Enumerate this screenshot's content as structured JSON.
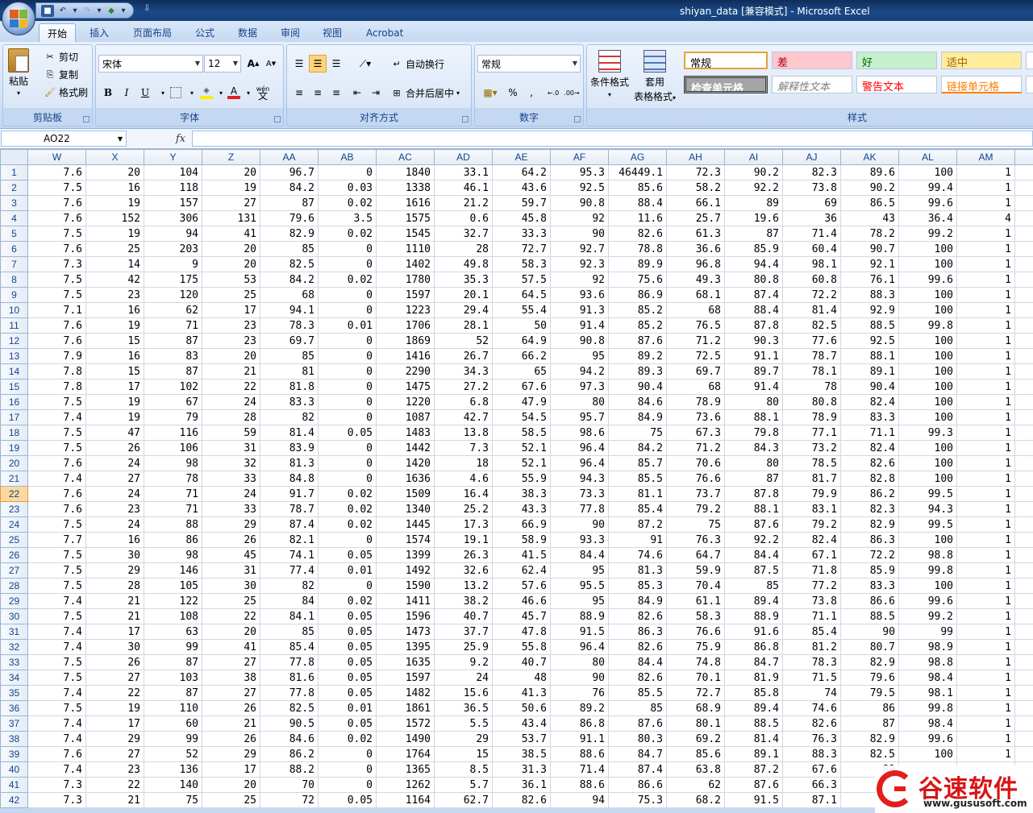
{
  "window": {
    "title": "shiyan_data  [兼容模式] - Microsoft Excel"
  },
  "tabs": [
    "开始",
    "插入",
    "页面布局",
    "公式",
    "数据",
    "审阅",
    "视图",
    "Acrobat"
  ],
  "ribbon": {
    "clipboard": {
      "label": "剪贴板",
      "paste": "粘贴",
      "cut": "剪切",
      "copy": "复制",
      "format_painter": "格式刷"
    },
    "font": {
      "label": "字体",
      "name": "宋体",
      "size": "12",
      "bold": "B",
      "italic": "I",
      "underline": "U",
      "grow": "A",
      "shrink": "A",
      "wen": "wén"
    },
    "alignment": {
      "label": "对齐方式",
      "wrap": "自动换行",
      "merge": "合并后居中"
    },
    "number": {
      "label": "数字",
      "format": "常规",
      "percent": "%",
      "comma": ","
    },
    "styles": {
      "label": "样式",
      "conditional": "条件格式",
      "table_fmt_1": "套用",
      "table_fmt_2": "表格格式",
      "normal": "常规",
      "bad": "差",
      "good": "好",
      "neutral": "适中",
      "check": "检查单元格",
      "explanatory": "解释性文本",
      "warning": "警告文本",
      "linked": "链接单元格"
    }
  },
  "formula_bar": {
    "name_box": "AO22",
    "fx": "fx",
    "value": ""
  },
  "sheet": {
    "columns": [
      "W",
      "X",
      "Y",
      "Z",
      "AA",
      "AB",
      "AC",
      "AD",
      "AE",
      "AF",
      "AG",
      "AH",
      "AI",
      "AJ",
      "AK",
      "AL",
      "AM"
    ],
    "selected_row": 22,
    "rows": [
      [
        "1",
        "7.6",
        "20",
        "104",
        "20",
        "96.7",
        "0",
        "1840",
        "33.1",
        "64.2",
        "95.3",
        "46449.1",
        "72.3",
        "90.2",
        "82.3",
        "89.6",
        "100",
        "1"
      ],
      [
        "2",
        "7.5",
        "16",
        "118",
        "19",
        "84.2",
        "0.03",
        "1338",
        "46.1",
        "43.6",
        "92.5",
        "85.6",
        "58.2",
        "92.2",
        "73.8",
        "90.2",
        "99.4",
        "1"
      ],
      [
        "3",
        "7.6",
        "19",
        "157",
        "27",
        "87",
        "0.02",
        "1616",
        "21.2",
        "59.7",
        "90.8",
        "88.4",
        "66.1",
        "89",
        "69",
        "86.5",
        "99.6",
        "1"
      ],
      [
        "4",
        "7.6",
        "152",
        "306",
        "131",
        "79.6",
        "3.5",
        "1575",
        "0.6",
        "45.8",
        "92",
        "11.6",
        "25.7",
        "19.6",
        "36",
        "43",
        "36.4",
        "4"
      ],
      [
        "5",
        "7.5",
        "19",
        "94",
        "41",
        "82.9",
        "0.02",
        "1545",
        "32.7",
        "33.3",
        "90",
        "82.6",
        "61.3",
        "87",
        "71.4",
        "78.2",
        "99.2",
        "1"
      ],
      [
        "6",
        "7.6",
        "25",
        "203",
        "20",
        "85",
        "0",
        "1110",
        "28",
        "72.7",
        "92.7",
        "78.8",
        "36.6",
        "85.9",
        "60.4",
        "90.7",
        "100",
        "1"
      ],
      [
        "7",
        "7.3",
        "14",
        "9",
        "20",
        "82.5",
        "0",
        "1402",
        "49.8",
        "58.3",
        "92.3",
        "89.9",
        "96.8",
        "94.4",
        "98.1",
        "92.1",
        "100",
        "1"
      ],
      [
        "8",
        "7.5",
        "42",
        "175",
        "53",
        "84.2",
        "0.02",
        "1780",
        "35.3",
        "57.5",
        "92",
        "75.6",
        "49.3",
        "80.8",
        "60.8",
        "76.1",
        "99.6",
        "1"
      ],
      [
        "9",
        "7.5",
        "23",
        "120",
        "25",
        "68",
        "0",
        "1597",
        "20.1",
        "64.5",
        "93.6",
        "86.9",
        "68.1",
        "87.4",
        "72.2",
        "88.3",
        "100",
        "1"
      ],
      [
        "10",
        "7.1",
        "16",
        "62",
        "17",
        "94.1",
        "0",
        "1223",
        "29.4",
        "55.4",
        "91.3",
        "85.2",
        "68",
        "88.4",
        "81.4",
        "92.9",
        "100",
        "1"
      ],
      [
        "11",
        "7.6",
        "19",
        "71",
        "23",
        "78.3",
        "0.01",
        "1706",
        "28.1",
        "50",
        "91.4",
        "85.2",
        "76.5",
        "87.8",
        "82.5",
        "88.5",
        "99.8",
        "1"
      ],
      [
        "12",
        "7.6",
        "15",
        "87",
        "23",
        "69.7",
        "0",
        "1869",
        "52",
        "64.9",
        "90.8",
        "87.6",
        "71.2",
        "90.3",
        "77.6",
        "92.5",
        "100",
        "1"
      ],
      [
        "13",
        "7.9",
        "16",
        "83",
        "20",
        "85",
        "0",
        "1416",
        "26.7",
        "66.2",
        "95",
        "89.2",
        "72.5",
        "91.1",
        "78.7",
        "88.1",
        "100",
        "1"
      ],
      [
        "14",
        "7.8",
        "15",
        "87",
        "21",
        "81",
        "0",
        "2290",
        "34.3",
        "65",
        "94.2",
        "89.3",
        "69.7",
        "89.7",
        "78.1",
        "89.1",
        "100",
        "1"
      ],
      [
        "15",
        "7.8",
        "17",
        "102",
        "22",
        "81.8",
        "0",
        "1475",
        "27.2",
        "67.6",
        "97.3",
        "90.4",
        "68",
        "91.4",
        "78",
        "90.4",
        "100",
        "1"
      ],
      [
        "16",
        "7.5",
        "19",
        "67",
        "24",
        "83.3",
        "0",
        "1220",
        "6.8",
        "47.9",
        "80",
        "84.6",
        "78.9",
        "80",
        "80.8",
        "82.4",
        "100",
        "1"
      ],
      [
        "17",
        "7.4",
        "19",
        "79",
        "28",
        "82",
        "0",
        "1087",
        "42.7",
        "54.5",
        "95.7",
        "84.9",
        "73.6",
        "88.1",
        "78.9",
        "83.3",
        "100",
        "1"
      ],
      [
        "18",
        "7.5",
        "47",
        "116",
        "59",
        "81.4",
        "0.05",
        "1483",
        "13.8",
        "58.5",
        "98.6",
        "75",
        "67.3",
        "79.8",
        "77.1",
        "71.1",
        "99.3",
        "1"
      ],
      [
        "19",
        "7.5",
        "26",
        "106",
        "31",
        "83.9",
        "0",
        "1442",
        "7.3",
        "52.1",
        "96.4",
        "84.2",
        "71.2",
        "84.3",
        "73.2",
        "82.4",
        "100",
        "1"
      ],
      [
        "20",
        "7.6",
        "24",
        "98",
        "32",
        "81.3",
        "0",
        "1420",
        "18",
        "52.1",
        "96.4",
        "85.7",
        "70.6",
        "80",
        "78.5",
        "82.6",
        "100",
        "1"
      ],
      [
        "21",
        "7.4",
        "27",
        "78",
        "33",
        "84.8",
        "0",
        "1636",
        "4.6",
        "55.9",
        "94.3",
        "85.5",
        "76.6",
        "87",
        "81.7",
        "82.8",
        "100",
        "1"
      ],
      [
        "22",
        "7.6",
        "24",
        "71",
        "24",
        "91.7",
        "0.02",
        "1509",
        "16.4",
        "38.3",
        "73.3",
        "81.1",
        "73.7",
        "87.8",
        "79.9",
        "86.2",
        "99.5",
        "1"
      ],
      [
        "23",
        "7.6",
        "23",
        "71",
        "33",
        "78.7",
        "0.02",
        "1340",
        "25.2",
        "43.3",
        "77.8",
        "85.4",
        "79.2",
        "88.1",
        "83.1",
        "82.3",
        "94.3",
        "1"
      ],
      [
        "24",
        "7.5",
        "24",
        "88",
        "29",
        "87.4",
        "0.02",
        "1445",
        "17.3",
        "66.9",
        "90",
        "87.2",
        "75",
        "87.6",
        "79.2",
        "82.9",
        "99.5",
        "1"
      ],
      [
        "25",
        "7.7",
        "16",
        "86",
        "26",
        "82.1",
        "0",
        "1574",
        "19.1",
        "58.9",
        "93.3",
        "91",
        "76.3",
        "92.2",
        "82.4",
        "86.3",
        "100",
        "1"
      ],
      [
        "26",
        "7.5",
        "30",
        "98",
        "45",
        "74.1",
        "0.05",
        "1399",
        "26.3",
        "41.5",
        "84.4",
        "74.6",
        "64.7",
        "84.4",
        "67.1",
        "72.2",
        "98.8",
        "1"
      ],
      [
        "27",
        "7.5",
        "29",
        "146",
        "31",
        "77.4",
        "0.01",
        "1492",
        "32.6",
        "62.4",
        "95",
        "81.3",
        "59.9",
        "87.5",
        "71.8",
        "85.9",
        "99.8",
        "1"
      ],
      [
        "28",
        "7.5",
        "28",
        "105",
        "30",
        "82",
        "0",
        "1590",
        "13.2",
        "57.6",
        "95.5",
        "85.3",
        "70.4",
        "85",
        "77.2",
        "83.3",
        "100",
        "1"
      ],
      [
        "29",
        "7.4",
        "21",
        "122",
        "25",
        "84",
        "0.02",
        "1411",
        "38.2",
        "46.6",
        "95",
        "84.9",
        "61.1",
        "89.4",
        "73.8",
        "86.6",
        "99.6",
        "1"
      ],
      [
        "30",
        "7.5",
        "21",
        "108",
        "22",
        "84.1",
        "0.05",
        "1596",
        "40.7",
        "45.7",
        "88.9",
        "82.6",
        "58.3",
        "88.9",
        "71.1",
        "88.5",
        "99.2",
        "1"
      ],
      [
        "31",
        "7.4",
        "17",
        "63",
        "20",
        "85",
        "0.05",
        "1473",
        "37.7",
        "47.8",
        "91.5",
        "86.3",
        "76.6",
        "91.6",
        "85.4",
        "90",
        "99",
        "1"
      ],
      [
        "32",
        "7.4",
        "30",
        "99",
        "41",
        "85.4",
        "0.05",
        "1395",
        "25.9",
        "55.8",
        "96.4",
        "82.6",
        "75.9",
        "86.8",
        "81.2",
        "80.7",
        "98.9",
        "1"
      ],
      [
        "33",
        "7.5",
        "26",
        "87",
        "27",
        "77.8",
        "0.05",
        "1635",
        "9.2",
        "40.7",
        "80",
        "84.4",
        "74.8",
        "84.7",
        "78.3",
        "82.9",
        "98.8",
        "1"
      ],
      [
        "34",
        "7.5",
        "27",
        "103",
        "38",
        "81.6",
        "0.05",
        "1597",
        "24",
        "48",
        "90",
        "82.6",
        "70.1",
        "81.9",
        "71.5",
        "79.6",
        "98.4",
        "1"
      ],
      [
        "35",
        "7.4",
        "22",
        "87",
        "27",
        "77.8",
        "0.05",
        "1482",
        "15.6",
        "41.3",
        "76",
        "85.5",
        "72.7",
        "85.8",
        "74",
        "79.5",
        "98.1",
        "1"
      ],
      [
        "36",
        "7.5",
        "19",
        "110",
        "26",
        "82.5",
        "0.01",
        "1861",
        "36.5",
        "50.6",
        "89.2",
        "85",
        "68.9",
        "89.4",
        "74.6",
        "86",
        "99.8",
        "1"
      ],
      [
        "37",
        "7.4",
        "17",
        "60",
        "21",
        "90.5",
        "0.05",
        "1572",
        "5.5",
        "43.4",
        "86.8",
        "87.6",
        "80.1",
        "88.5",
        "82.6",
        "87",
        "98.4",
        "1"
      ],
      [
        "38",
        "7.4",
        "29",
        "99",
        "26",
        "84.6",
        "0.02",
        "1490",
        "29",
        "53.7",
        "91.1",
        "80.3",
        "69.2",
        "81.4",
        "76.3",
        "82.9",
        "99.6",
        "1"
      ],
      [
        "39",
        "7.6",
        "27",
        "52",
        "29",
        "86.2",
        "0",
        "1764",
        "15",
        "38.5",
        "88.6",
        "84.7",
        "85.6",
        "89.1",
        "88.3",
        "82.5",
        "100",
        "1"
      ],
      [
        "40",
        "7.4",
        "23",
        "136",
        "17",
        "88.2",
        "0",
        "1365",
        "8.5",
        "31.3",
        "71.4",
        "87.4",
        "63.8",
        "87.2",
        "67.6",
        "89",
        "",
        ""
      ],
      [
        "41",
        "7.3",
        "22",
        "140",
        "20",
        "70",
        "0",
        "1262",
        "5.7",
        "36.1",
        "88.6",
        "86.6",
        "62",
        "87.6",
        "66.3",
        "",
        "",
        ""
      ],
      [
        "42",
        "7.3",
        "21",
        "75",
        "25",
        "72",
        "0.05",
        "1164",
        "62.7",
        "82.6",
        "94",
        "75.3",
        "68.2",
        "91.5",
        "87.1",
        "",
        "",
        ""
      ]
    ]
  },
  "watermark": {
    "title": "谷速软件",
    "url": "www.gususoft.com",
    "color": "#d71515"
  }
}
